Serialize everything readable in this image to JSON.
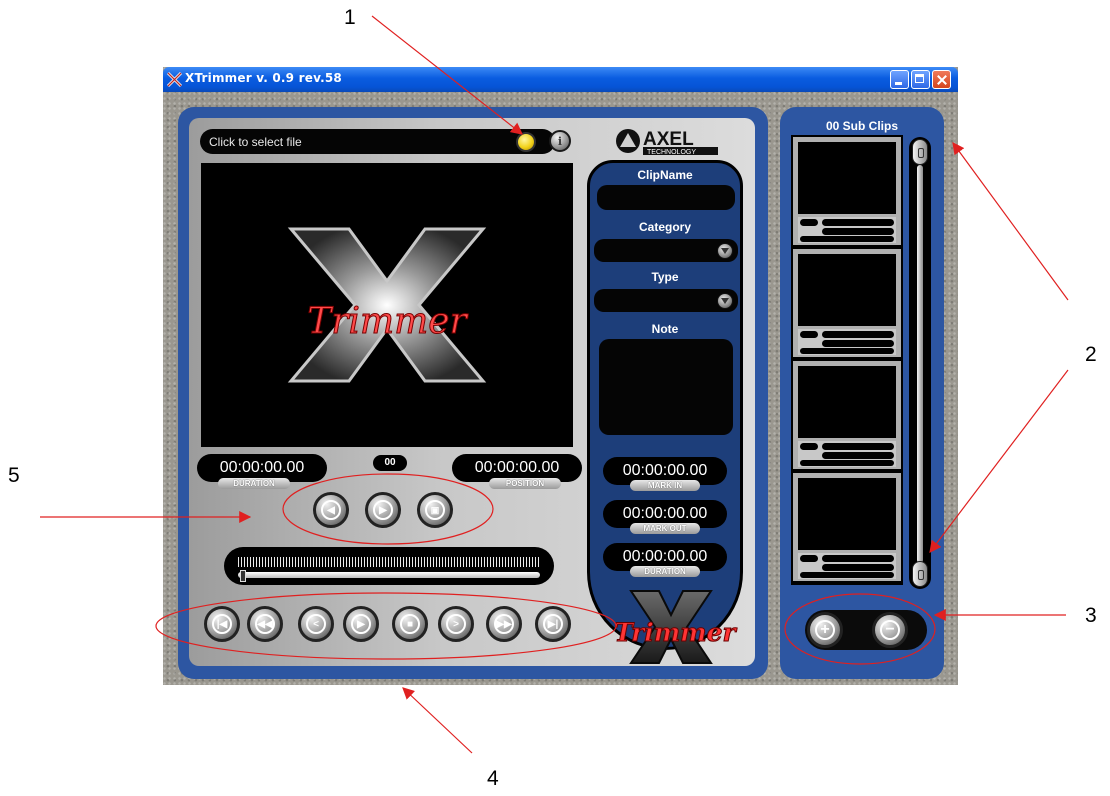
{
  "callouts": [
    "1",
    "2",
    "3",
    "4",
    "5"
  ],
  "colors": {
    "callout_arrow": "#e02020",
    "panel_blue": "#2d56a2",
    "led_yellow": "#f2d21a"
  },
  "window": {
    "title": "XTrimmer v. 0.9  rev.58",
    "controls": [
      "minimize-icon",
      "maximize-icon",
      "close-icon"
    ]
  },
  "file": {
    "placeholder": "Click to select file"
  },
  "logo": {
    "brand": "AXEL",
    "sub": "TECHNOLOGY",
    "product": "Trimmer"
  },
  "video": {
    "logo_letter": "X",
    "logo_text": "Trimmer"
  },
  "timecodes": {
    "duration": {
      "value": "00:00:00.00",
      "label": "DURATION"
    },
    "position": {
      "value": "00:00:00.00",
      "label": "POSITION"
    },
    "counter": "00"
  },
  "clip": {
    "clipname_label": "ClipName",
    "clipname_value": "",
    "category_label": "Category",
    "category_value": "",
    "type_label": "Type",
    "type_value": "",
    "note_label": "Note",
    "note_value": "",
    "mark_in": {
      "value": "00:00:00.00",
      "label": "MARK IN"
    },
    "mark_out": {
      "value": "00:00:00.00",
      "label": "MARK OUT"
    },
    "duration": {
      "value": "00:00:00.00",
      "label": "DURATION"
    }
  },
  "edit_buttons": [
    "mark-in-icon",
    "mark-out-icon",
    "snapshot-icon"
  ],
  "transport": [
    "skip-to-start-icon",
    "fast-rewind-icon",
    "rewind-icon",
    "play-icon",
    "stop-icon",
    "forward-icon",
    "fast-forward-icon",
    "skip-to-end-icon"
  ],
  "sub_clips": {
    "title": "00 Sub Clips",
    "count": 4
  },
  "sub_clip_controls": [
    "add-icon",
    "remove-icon"
  ],
  "slider": {
    "position": 0
  }
}
